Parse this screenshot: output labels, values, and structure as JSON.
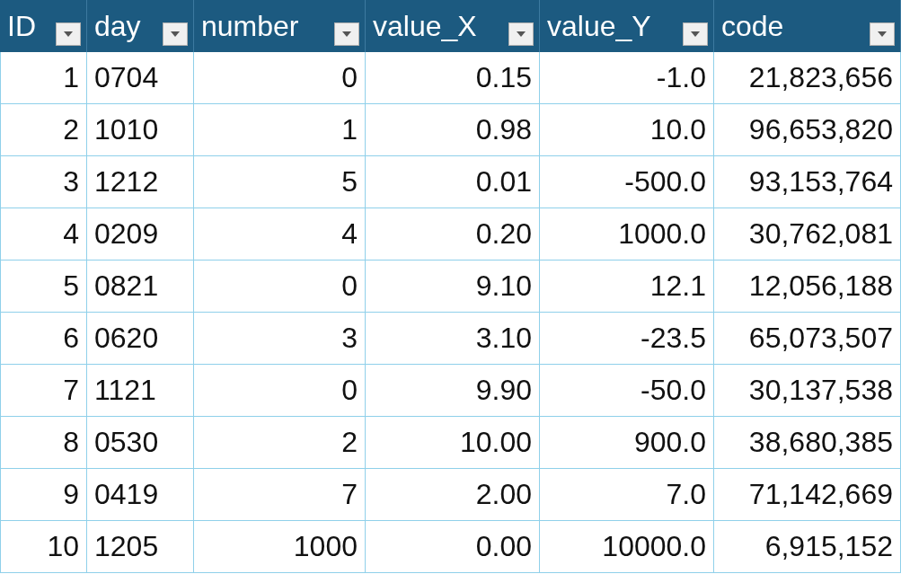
{
  "table": {
    "columns": [
      {
        "label": "ID",
        "kind": "number"
      },
      {
        "label": "day",
        "kind": "text"
      },
      {
        "label": "number",
        "kind": "number"
      },
      {
        "label": "value_X",
        "kind": "number"
      },
      {
        "label": "value_Y",
        "kind": "number"
      },
      {
        "label": "code",
        "kind": "number"
      }
    ],
    "rows": [
      [
        "1",
        "0704",
        "0",
        "0.15",
        "-1.0",
        "21,823,656"
      ],
      [
        "2",
        "1010",
        "1",
        "0.98",
        "10.0",
        "96,653,820"
      ],
      [
        "3",
        "1212",
        "5",
        "0.01",
        "-500.0",
        "93,153,764"
      ],
      [
        "4",
        "0209",
        "4",
        "0.20",
        "1000.0",
        "30,762,081"
      ],
      [
        "5",
        "0821",
        "0",
        "9.10",
        "12.1",
        "12,056,188"
      ],
      [
        "6",
        "0620",
        "3",
        "3.10",
        "-23.5",
        "65,073,507"
      ],
      [
        "7",
        "1121",
        "0",
        "9.90",
        "-50.0",
        "30,137,538"
      ],
      [
        "8",
        "0530",
        "2",
        "10.00",
        "900.0",
        "38,680,385"
      ],
      [
        "9",
        "0419",
        "7",
        "2.00",
        "7.0",
        "71,142,669"
      ],
      [
        "10",
        "1205",
        "1000",
        "0.00",
        "10000.0",
        "6,915,152"
      ]
    ]
  }
}
